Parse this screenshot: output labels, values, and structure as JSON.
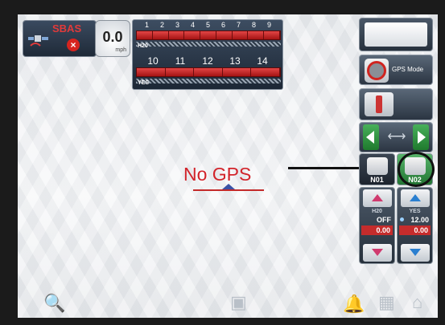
{
  "status": {
    "sbas_label": "SBAS",
    "no_signal_mark": "×",
    "speed_value": "0.0",
    "speed_unit": "mph"
  },
  "sections": {
    "row1_numbers": [
      "1",
      "2",
      "3",
      "4",
      "5",
      "6",
      "7",
      "8",
      "9"
    ],
    "row1_tag": "H20",
    "row2_numbers": [
      "10",
      "11",
      "12",
      "13",
      "14"
    ],
    "row2_tag": "YES"
  },
  "map": {
    "message": "No GPS"
  },
  "side_panel": {
    "gps_mode_label": "GPS Mode",
    "shift_symbol": "⟷",
    "products": [
      {
        "label": "N01"
      },
      {
        "label": "N02"
      }
    ],
    "rate_a": {
      "name": "H20",
      "value1": "OFF",
      "value2": "0.00"
    },
    "rate_b": {
      "name": "YES",
      "value1": "12.00",
      "value2": "0.00"
    }
  },
  "toolbar": {
    "search_icon": "🔍",
    "boom_icon": "▣",
    "bell_icon": "🔔",
    "grid_icon": "▦",
    "home_icon": "⌂"
  },
  "colors": {
    "alert_red": "#d2232a",
    "active_green": "#3aa04c",
    "panel_dark": "#27313d"
  }
}
